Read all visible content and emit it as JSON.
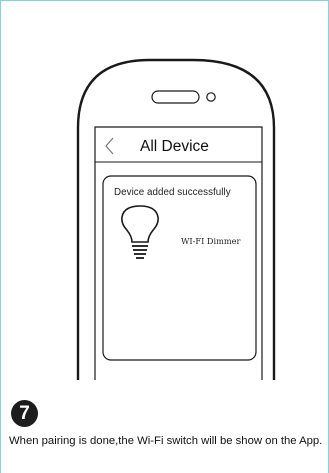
{
  "screen": {
    "nav_title": "All Device",
    "success_message": "Device added successfully",
    "device_name": "WI-FI Dimmer"
  },
  "step": {
    "number": "7",
    "instruction": "When pairing is done,the Wi-Fi switch will be show on the App."
  },
  "icons": {
    "back": "chevron-left-icon",
    "device": "light-bulb-icon"
  },
  "colors": {
    "frame_border": "#7fd3e8",
    "phone_outline": "#1a1a1a",
    "step_badge": "#1d1d1d"
  }
}
